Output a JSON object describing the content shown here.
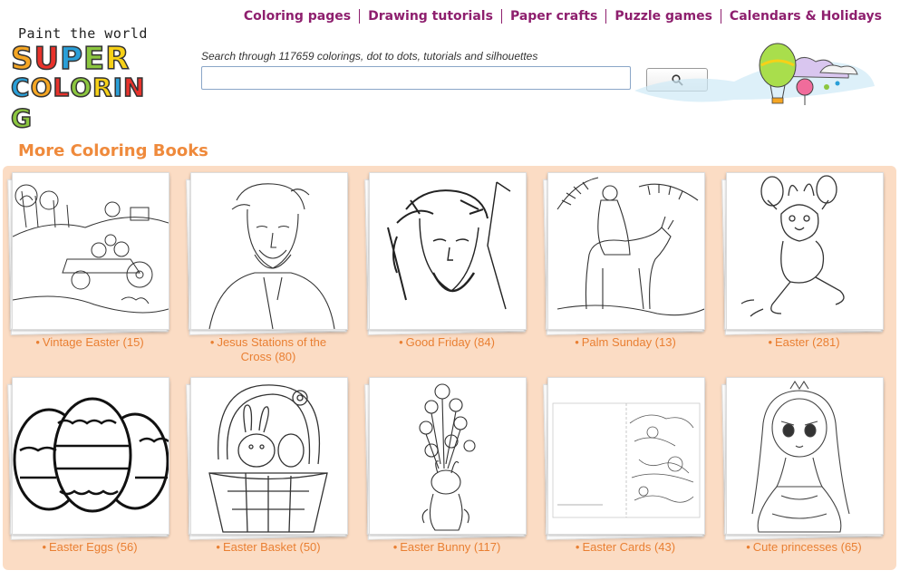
{
  "brand": {
    "tagline": "Paint the world",
    "line1": "SUPER",
    "line2": "COLORING"
  },
  "nav": [
    {
      "label": "Coloring pages"
    },
    {
      "label": "Drawing tutorials"
    },
    {
      "label": "Paper crafts"
    },
    {
      "label": "Puzzle games"
    },
    {
      "label": "Calendars & Holidays"
    }
  ],
  "search": {
    "label": "Search through 117659 colorings, dot to dots, tutorials and silhouettes",
    "value": "",
    "button_icon": "search-icon"
  },
  "section": {
    "title": "More Coloring Books"
  },
  "books": [
    {
      "label": "Vintage Easter (15)",
      "icon": "vintage-easter-drawing"
    },
    {
      "label": "Jesus Stations of the Cross (80)",
      "icon": "jesus-drawing"
    },
    {
      "label": "Good Friday (84)",
      "icon": "good-friday-drawing"
    },
    {
      "label": "Palm Sunday (13)",
      "icon": "palm-sunday-drawing"
    },
    {
      "label": "Easter (281)",
      "icon": "easter-bunny-drawing"
    },
    {
      "label": "Easter Eggs (56)",
      "icon": "easter-eggs-drawing"
    },
    {
      "label": "Easter Basket (50)",
      "icon": "easter-basket-drawing"
    },
    {
      "label": "Easter Bunny (117)",
      "icon": "easter-bunny-flowers-drawing"
    },
    {
      "label": "Easter Cards (43)",
      "icon": "easter-card-drawing"
    },
    {
      "label": "Cute princesses (65)",
      "icon": "princess-drawing"
    }
  ],
  "colors": {
    "nav": "#8e1f6e",
    "accent": "#ef8a3c",
    "panel": "#fbdcc4"
  }
}
